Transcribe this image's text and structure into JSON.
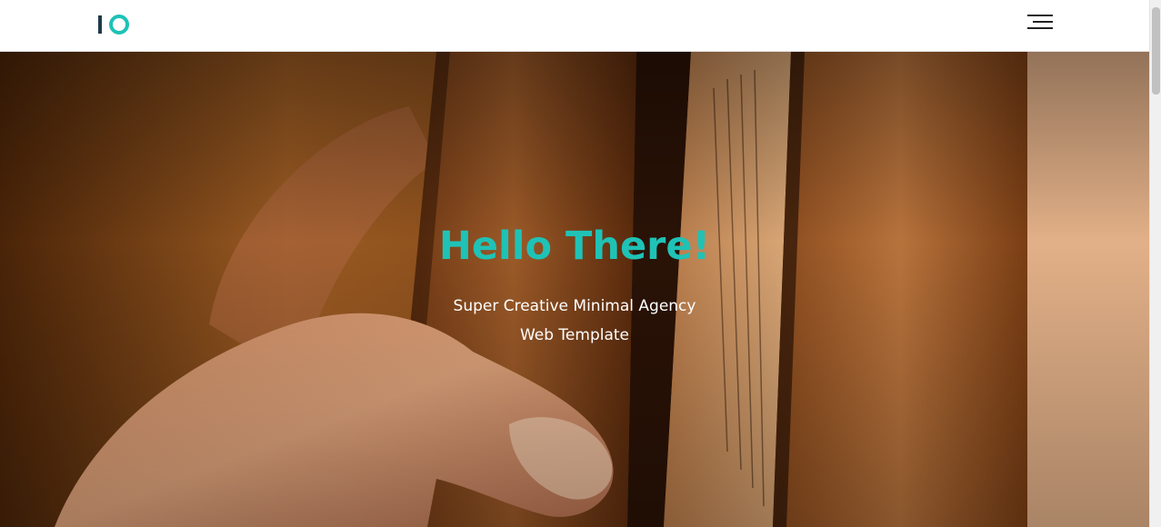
{
  "header": {
    "logo_alt": "IO",
    "menu_icon": "hamburger-menu-icon"
  },
  "hero": {
    "title": "Hello There!",
    "subtitle": "Super Creative Minimal Agency Web Template",
    "background": "hand-holding-book-photo"
  },
  "colors": {
    "accent": "#1fc2b6",
    "logo_dark": "#1e3b4a",
    "header_bg": "#ffffff",
    "hero_text": "#ffffff"
  }
}
